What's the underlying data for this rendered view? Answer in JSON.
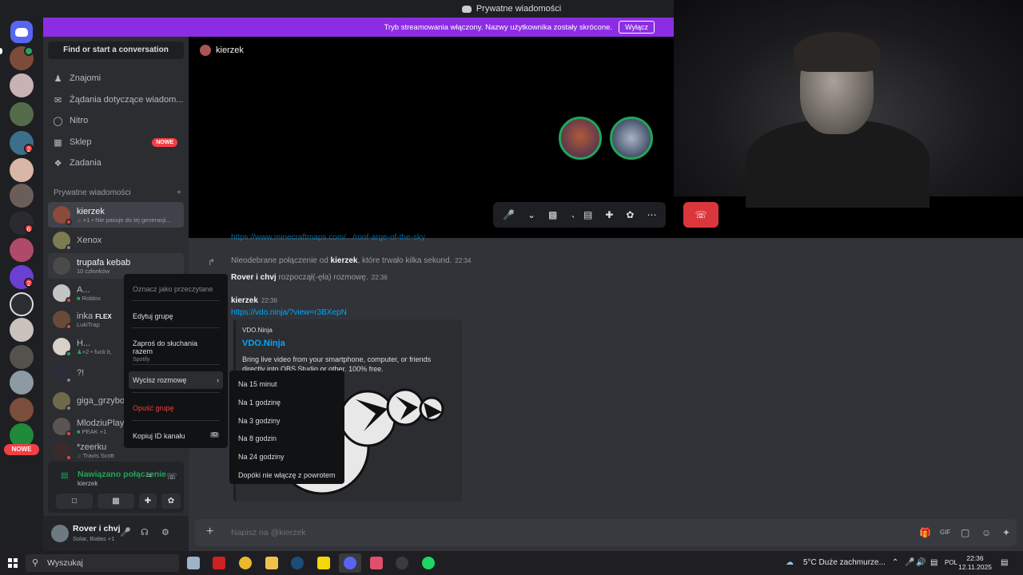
{
  "titlebar": {
    "title": "Prywatne wiadomości"
  },
  "banner": {
    "text": "Tryb streamowania włączony. Nazwy użytkownika zostały skrócone.",
    "button": "Wyłącz"
  },
  "sidebar": {
    "search": "Find or start a conversation",
    "nav": [
      {
        "label": "Znajomi",
        "icon": "friends-icon"
      },
      {
        "label": "Żądania dotyczące wiadom...",
        "icon": "mail-icon"
      },
      {
        "label": "Nitro",
        "icon": "nitro-icon"
      },
      {
        "label": "Sklep",
        "icon": "shop-icon",
        "tag": "NOWE"
      },
      {
        "label": "Zadania",
        "icon": "quests-icon"
      }
    ],
    "section_title": "Prywatne wiadomości",
    "dms": [
      {
        "name": "kierzek",
        "sub": "+1 • Nie pasuje do tej generacji...",
        "color": "#8a4b3a"
      },
      {
        "name": "Xenox",
        "sub": "",
        "color": "#7c7c52"
      },
      {
        "name": "trupafa kebab",
        "sub": "10 członków",
        "color": "#4a4a4a"
      },
      {
        "name": "A...",
        "sub": "Roblox",
        "color": "#c4c4c4"
      },
      {
        "name": "inka",
        "sub": "LukiTrap",
        "color": "#6b4a3a",
        "flex": "FLEX"
      },
      {
        "name": "H...",
        "sub": "+2 • fuck it,",
        "sub2": "Spotify",
        "color": "#d9d0c8"
      },
      {
        "name": "?!",
        "sub": "",
        "color": "#2c2c3a"
      },
      {
        "name": "giga_grzybol",
        "sub": "",
        "color": "#6d6a4b"
      },
      {
        "name": "MlodziuPlaya",
        "sub": "PEAK +1",
        "color": "#5a5552"
      },
      {
        "name": "*zeerku",
        "sub": "Travis Scott",
        "color": "#3b2a2a"
      }
    ]
  },
  "voice": {
    "status": "Nawiązano połączenie",
    "channel": "kierzek"
  },
  "user": {
    "name": "Rover i chvj",
    "status": "Solar, Białas +1"
  },
  "call": {
    "header": "kierzek"
  },
  "chat": {
    "link_partial": "https://www.minecraftmaps.com/.../roof-arge-of-the-sky",
    "missed_call": {
      "prefix": "Nieodebrane połączenie od ",
      "user": "kierzek",
      "suffix": ", które trwało kilka sekund.",
      "time": "22:34"
    },
    "started_call": {
      "user": "Rover i chvj",
      "text": " rozpoczął(-ęła) rozmowę.",
      "time": "22:36"
    },
    "message": {
      "author": "kierzek",
      "time": "22:36",
      "link": "https://vdo.ninja/?view=r3BXepN"
    },
    "embed": {
      "provider": "VDO.Ninja",
      "title": "VDO.Ninja",
      "description": "Bring live video from your smartphone, computer, or friends directly into OBS Studio or other. 100% free."
    },
    "placeholder": "Napisz na @kierzek"
  },
  "context_menu": {
    "mark_read": "Oznacz jako przeczytane",
    "edit_group": "Edytuj grupę",
    "invite_listen": "Zaproś do słuchania razem",
    "invite_listen_sub": "Spotify",
    "mute": "Wycisz rozmowę",
    "leave": "Opuść grupę",
    "copy_id": "Kopiuj ID kanału"
  },
  "mute_submenu": [
    "Na 15 minut",
    "Na 1 godzinę",
    "Na 3 godziny",
    "Na 8 godzin",
    "Na 24 godziny",
    "Dopóki nie włączę z powrotem"
  ],
  "rail": {
    "new_badge": "NOWE"
  },
  "taskbar": {
    "search": "Wyszukaj",
    "weather": "5°C  Duże zachmurze...",
    "lang": "POL",
    "time": "22:36",
    "date": "12.11.2025"
  },
  "colors": {
    "accent": "#5865f2",
    "banner": "#8c2de3",
    "danger": "#da373c",
    "online": "#23a55a"
  }
}
